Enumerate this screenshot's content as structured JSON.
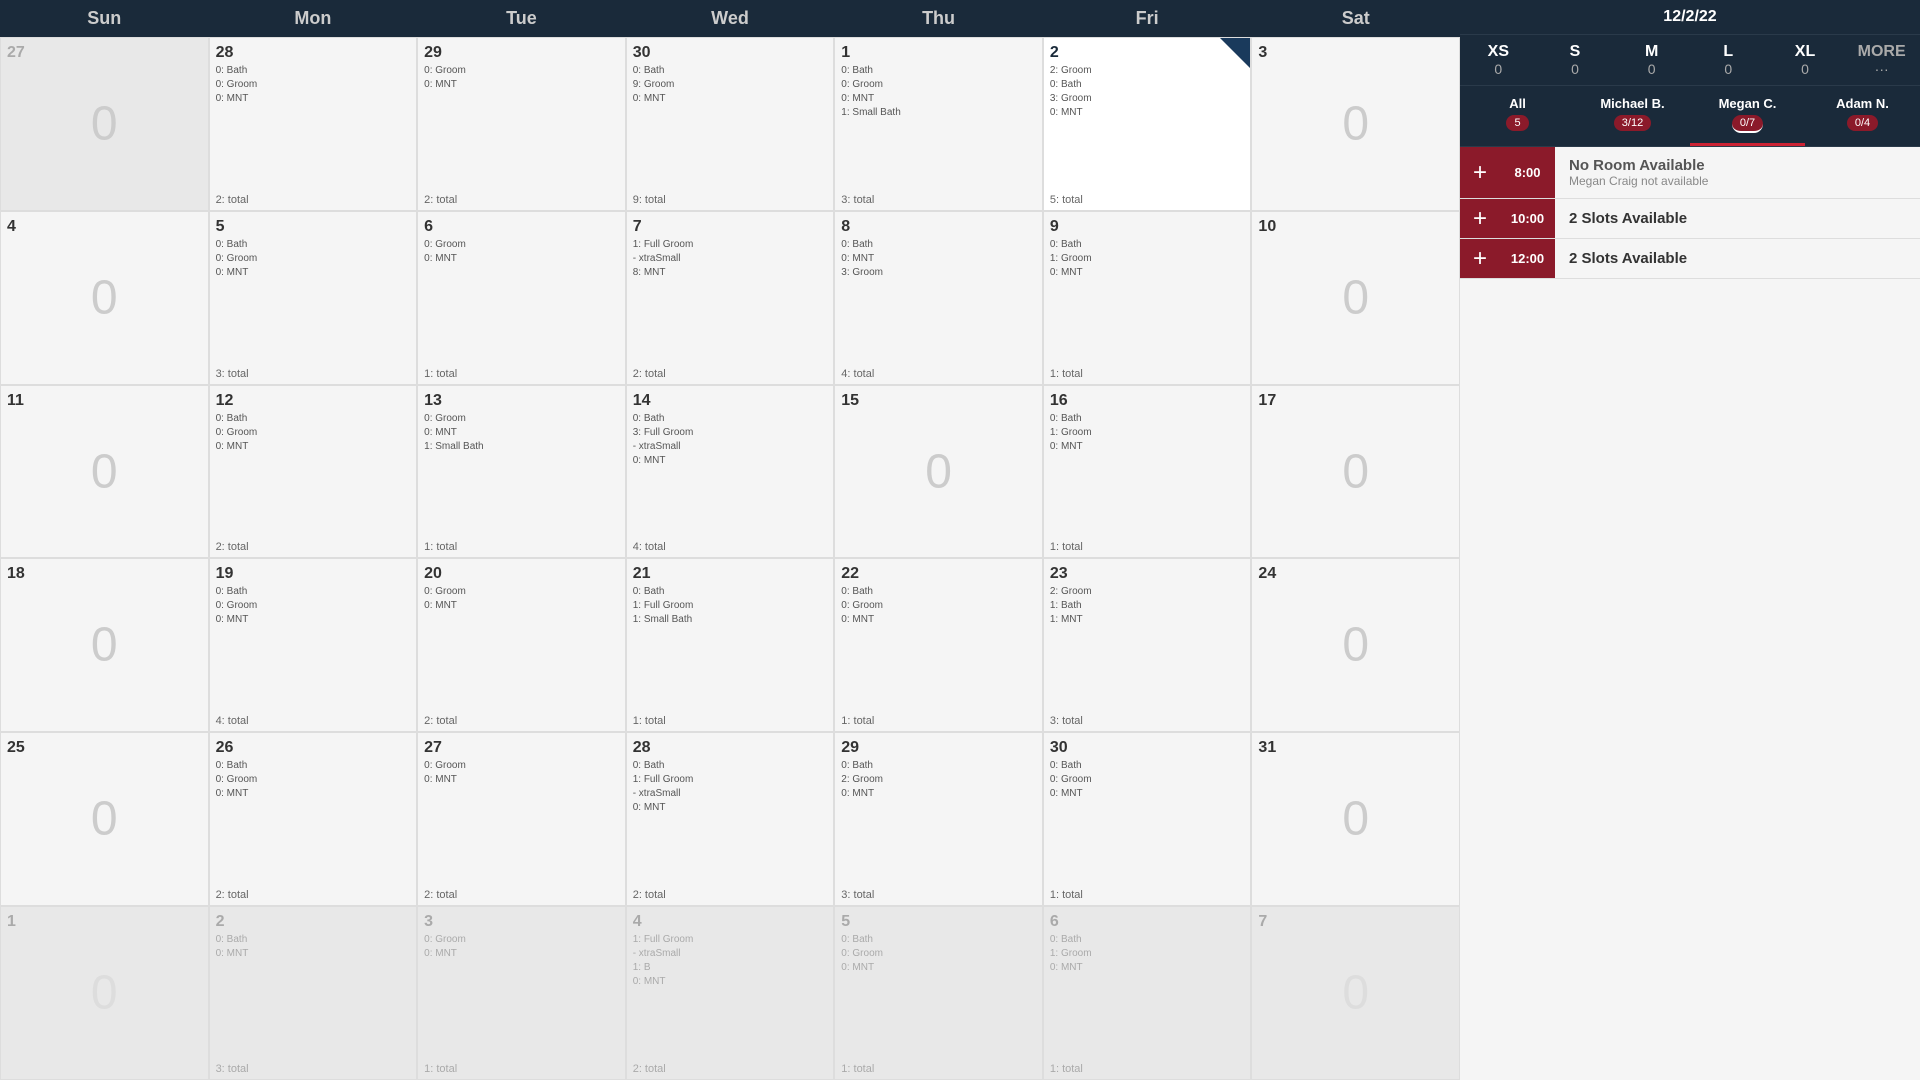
{
  "header": {
    "date": "12/2/22",
    "days": [
      "Sun",
      "Mon",
      "Tue",
      "Wed",
      "Thu",
      "Fri",
      "Sat"
    ]
  },
  "sizeFilters": [
    {
      "label": "XS",
      "count": "0"
    },
    {
      "label": "S",
      "count": "0"
    },
    {
      "label": "M",
      "count": "0"
    },
    {
      "label": "L",
      "count": "0"
    },
    {
      "label": "XL",
      "count": "0"
    },
    {
      "label": "MORE",
      "count": "···"
    }
  ],
  "personFilters": [
    {
      "name": "All",
      "count": "5",
      "style": "all"
    },
    {
      "name": "Michael B.",
      "count": "3/12",
      "style": "michael"
    },
    {
      "name": "Megan C.",
      "count": "0/7",
      "style": "megan",
      "active": true
    },
    {
      "name": "Adam N.",
      "count": "0/4",
      "style": "adam"
    }
  ],
  "timeSlots": [
    {
      "time": "8:00",
      "title": "No Room Available",
      "subtitle": "Megan Craig not available",
      "available": false
    },
    {
      "time": "10:00",
      "title": "2 Slots Available",
      "subtitle": "",
      "available": true
    },
    {
      "time": "12:00",
      "title": "2 Slots Available",
      "subtitle": "",
      "available": true
    }
  ],
  "weeks": [
    {
      "cells": [
        {
          "date": "27",
          "otherMonth": true,
          "events": [],
          "total": "",
          "zero": true
        },
        {
          "date": "28",
          "otherMonth": false,
          "events": [
            "0: Bath",
            "0: Groom",
            "0: MNT"
          ],
          "total": "2: total",
          "zero": false
        },
        {
          "date": "29",
          "otherMonth": false,
          "events": [
            "0: Groom",
            "0: MNT"
          ],
          "total": "2: total",
          "zero": false
        },
        {
          "date": "30",
          "otherMonth": false,
          "events": [
            "0: Bath",
            "9: Groom",
            "0: MNT"
          ],
          "total": "9: total",
          "zero": false
        },
        {
          "date": "1",
          "otherMonth": false,
          "events": [
            "0: Bath",
            "0: Groom",
            "0: MNT",
            "1: Small Bath"
          ],
          "total": "3: total",
          "zero": false
        },
        {
          "date": "2",
          "otherMonth": false,
          "today": true,
          "events": [
            "0: Bath",
            "3: Groom",
            "0: MNT"
          ],
          "total": "5: total",
          "zero": false
        },
        {
          "date": "3",
          "otherMonth": false,
          "events": [],
          "total": "",
          "zero": true
        }
      ]
    },
    {
      "cells": [
        {
          "date": "4",
          "otherMonth": false,
          "events": [],
          "total": "",
          "zero": true
        },
        {
          "date": "5",
          "otherMonth": false,
          "events": [
            "0: Bath",
            "0: Groom",
            "0: MNT"
          ],
          "total": "3: total",
          "zero": false
        },
        {
          "date": "6",
          "otherMonth": false,
          "events": [
            "0: Groom",
            "0: MNT"
          ],
          "total": "1: total",
          "zero": false
        },
        {
          "date": "7",
          "otherMonth": false,
          "events": [
            "1: Full Groom",
            "- xtraSmall",
            "8: MNT"
          ],
          "total": "2: total",
          "zero": false
        },
        {
          "date": "8",
          "otherMonth": false,
          "events": [
            "0: Bath",
            "0: MNT",
            "3: Groom"
          ],
          "total": "4: total",
          "zero": false
        },
        {
          "date": "9",
          "otherMonth": false,
          "events": [
            "0: Bath",
            "1: Groom",
            "0: MNT"
          ],
          "total": "1: total",
          "zero": false
        },
        {
          "date": "10",
          "otherMonth": false,
          "events": [],
          "total": "",
          "zero": true
        }
      ]
    },
    {
      "cells": [
        {
          "date": "11",
          "otherMonth": false,
          "events": [],
          "total": "",
          "zero": true
        },
        {
          "date": "12",
          "otherMonth": false,
          "events": [
            "0: Bath",
            "0: Groom",
            "0: MNT"
          ],
          "total": "2: total",
          "zero": false
        },
        {
          "date": "13",
          "otherMonth": false,
          "events": [
            "0: Groom",
            "0: MNT",
            "1: Small Bath"
          ],
          "total": "1: total",
          "zero": false
        },
        {
          "date": "14",
          "otherMonth": false,
          "events": [
            "0: Bath",
            "3: Full Groom",
            "- xtraSmall",
            "0: MNT"
          ],
          "total": "4: total",
          "zero": false
        },
        {
          "date": "15",
          "otherMonth": false,
          "events": [],
          "total": "",
          "zero": true
        },
        {
          "date": "16",
          "otherMonth": false,
          "events": [
            "0: Bath",
            "1: Groom",
            "0: MNT"
          ],
          "total": "1: total",
          "zero": false
        },
        {
          "date": "17",
          "otherMonth": false,
          "events": [],
          "total": "",
          "zero": true
        }
      ]
    },
    {
      "cells": [
        {
          "date": "18",
          "otherMonth": false,
          "events": [],
          "total": "",
          "zero": true
        },
        {
          "date": "19",
          "otherMonth": false,
          "events": [
            "0: Bath",
            "0: Groom",
            "0: MNT"
          ],
          "total": "4: total",
          "zero": false
        },
        {
          "date": "20",
          "otherMonth": false,
          "events": [
            "0: Groom",
            "0: MNT"
          ],
          "total": "2: total",
          "zero": false
        },
        {
          "date": "21",
          "otherMonth": false,
          "events": [
            "0: Bath",
            "1: Full Groom",
            "1: Small Bath"
          ],
          "total": "1: total",
          "zero": false
        },
        {
          "date": "22",
          "otherMonth": false,
          "events": [
            "0: Bath",
            "0: Groom",
            "0: MNT"
          ],
          "total": "1: total",
          "zero": false
        },
        {
          "date": "23",
          "otherMonth": false,
          "events": [
            "2: Groom",
            "1: Bath",
            "1: MNT"
          ],
          "total": "3: total",
          "zero": false
        },
        {
          "date": "24",
          "otherMonth": false,
          "events": [],
          "total": "",
          "zero": true
        }
      ]
    },
    {
      "cells": [
        {
          "date": "25",
          "otherMonth": false,
          "events": [],
          "total": "",
          "zero": true
        },
        {
          "date": "26",
          "otherMonth": false,
          "events": [
            "0: Bath",
            "0: Groom",
            "0: MNT"
          ],
          "total": "2: total",
          "zero": false
        },
        {
          "date": "27",
          "otherMonth": false,
          "events": [
            "0: Groom",
            "0: MNT"
          ],
          "total": "2: total",
          "zero": false
        },
        {
          "date": "28",
          "otherMonth": false,
          "events": [
            "0: Bath",
            "1: Full Groom",
            "- xtraSmall",
            "0: MNT"
          ],
          "total": "2: total",
          "zero": false
        },
        {
          "date": "29",
          "otherMonth": false,
          "events": [
            "0: Bath",
            "2: Groom",
            "0: MNT"
          ],
          "total": "3: total",
          "zero": false
        },
        {
          "date": "30",
          "otherMonth": false,
          "events": [
            "0: Bath",
            "0: Groom",
            "0: MNT"
          ],
          "total": "1: total",
          "zero": false
        },
        {
          "date": "31",
          "otherMonth": false,
          "events": [],
          "total": "",
          "zero": true
        }
      ]
    },
    {
      "cells": [
        {
          "date": "1",
          "otherMonth": true,
          "events": [],
          "total": "",
          "zero": true
        },
        {
          "date": "2",
          "otherMonth": true,
          "events": [
            "0: Bath",
            "0: MNT"
          ],
          "total": "3: total",
          "zero": false
        },
        {
          "date": "3",
          "otherMonth": true,
          "events": [
            "0: Groom",
            "0: MNT"
          ],
          "total": "1: total",
          "zero": false
        },
        {
          "date": "4",
          "otherMonth": true,
          "events": [
            "1: Full Groom",
            "- xtraSmall",
            "1: B",
            "0: MNT"
          ],
          "total": "2: total",
          "zero": false
        },
        {
          "date": "5",
          "otherMonth": true,
          "events": [
            "0: Bath",
            "0: Groom",
            "0: MNT"
          ],
          "total": "1: total",
          "zero": false
        },
        {
          "date": "6",
          "otherMonth": true,
          "events": [
            "0: Bath",
            "1: Groom",
            "0: MNT"
          ],
          "total": "1: total",
          "zero": false
        },
        {
          "date": "7",
          "otherMonth": true,
          "events": [],
          "total": "",
          "zero": true
        }
      ]
    }
  ]
}
